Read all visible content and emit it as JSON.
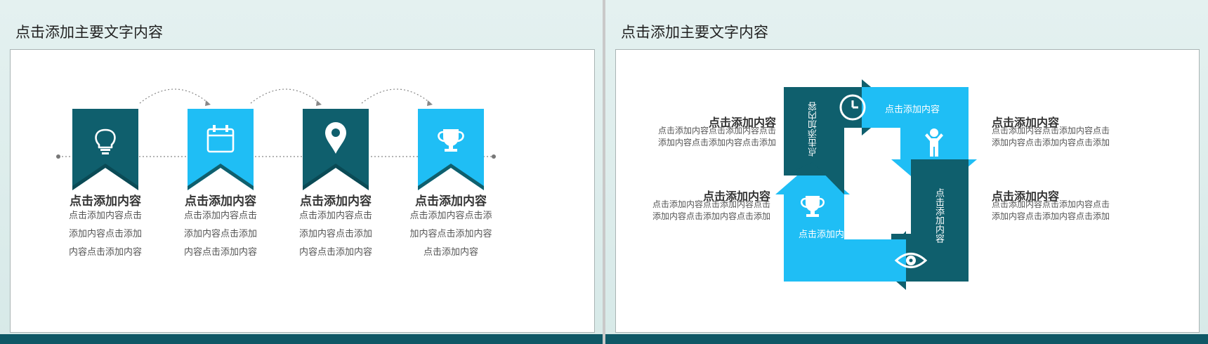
{
  "colors": {
    "dark_teal": "#0f5f6d",
    "bright_blue": "#1fbef5",
    "text_dark": "#333333",
    "text_gray": "#555555"
  },
  "left_slide": {
    "title": "点击添加主要文字内容",
    "steps": [
      {
        "icon": "lightbulb-icon",
        "color": "dark_teal",
        "title": "点击添加内容",
        "body_lines": [
          "点击添加内容点击",
          "添加内容点击添加",
          "内容点击添加内容"
        ]
      },
      {
        "icon": "calendar-icon",
        "color": "bright_blue",
        "title": "点击添加内容",
        "body_lines": [
          "点击添加内容点击",
          "添加内容点击添加",
          "内容点击添加内容"
        ]
      },
      {
        "icon": "location-pin-icon",
        "color": "dark_teal",
        "title": "点击添加内容",
        "body_lines": [
          "点击添加内容点击",
          "添加内容点击添加",
          "内容点击添加内容"
        ]
      },
      {
        "icon": "trophy-icon",
        "color": "bright_blue",
        "title": "点击添加内容",
        "body_lines": [
          "点击添加内容点击添",
          "加内容点击添加内容",
          "点击添加内容"
        ]
      }
    ]
  },
  "right_slide": {
    "title": "点击添加主要文字内容",
    "cycle": {
      "top_arrow_label": "点击添加内容",
      "left_arrow_label": "点击添加内容",
      "right_arrow_label": "点击添加内容",
      "bottom_arrow_label": "点击添加内容",
      "icons": [
        "clock-icon",
        "person-icon",
        "eye-icon",
        "trophy-icon"
      ]
    },
    "side_items": {
      "top_left": {
        "title": "点击添加内容",
        "body_lines": [
          "点击添加内容点击添加内容点击",
          "添加内容点击添加内容点击添加"
        ]
      },
      "bottom_left": {
        "title": "点击添加内容",
        "body_lines": [
          "点击添加内容点击添加内容点击",
          "添加内容点击添加内容点击添加"
        ]
      },
      "top_right": {
        "title": "点击添加内容",
        "body_lines": [
          "点击添加内容点击添加内容点击",
          "添加内容点击添加内容点击添加"
        ]
      },
      "bottom_right": {
        "title": "点击添加内容",
        "body_lines": [
          "点击添加内容点击添加内容点击",
          "添加内容点击添加内容点击添加"
        ]
      }
    }
  }
}
